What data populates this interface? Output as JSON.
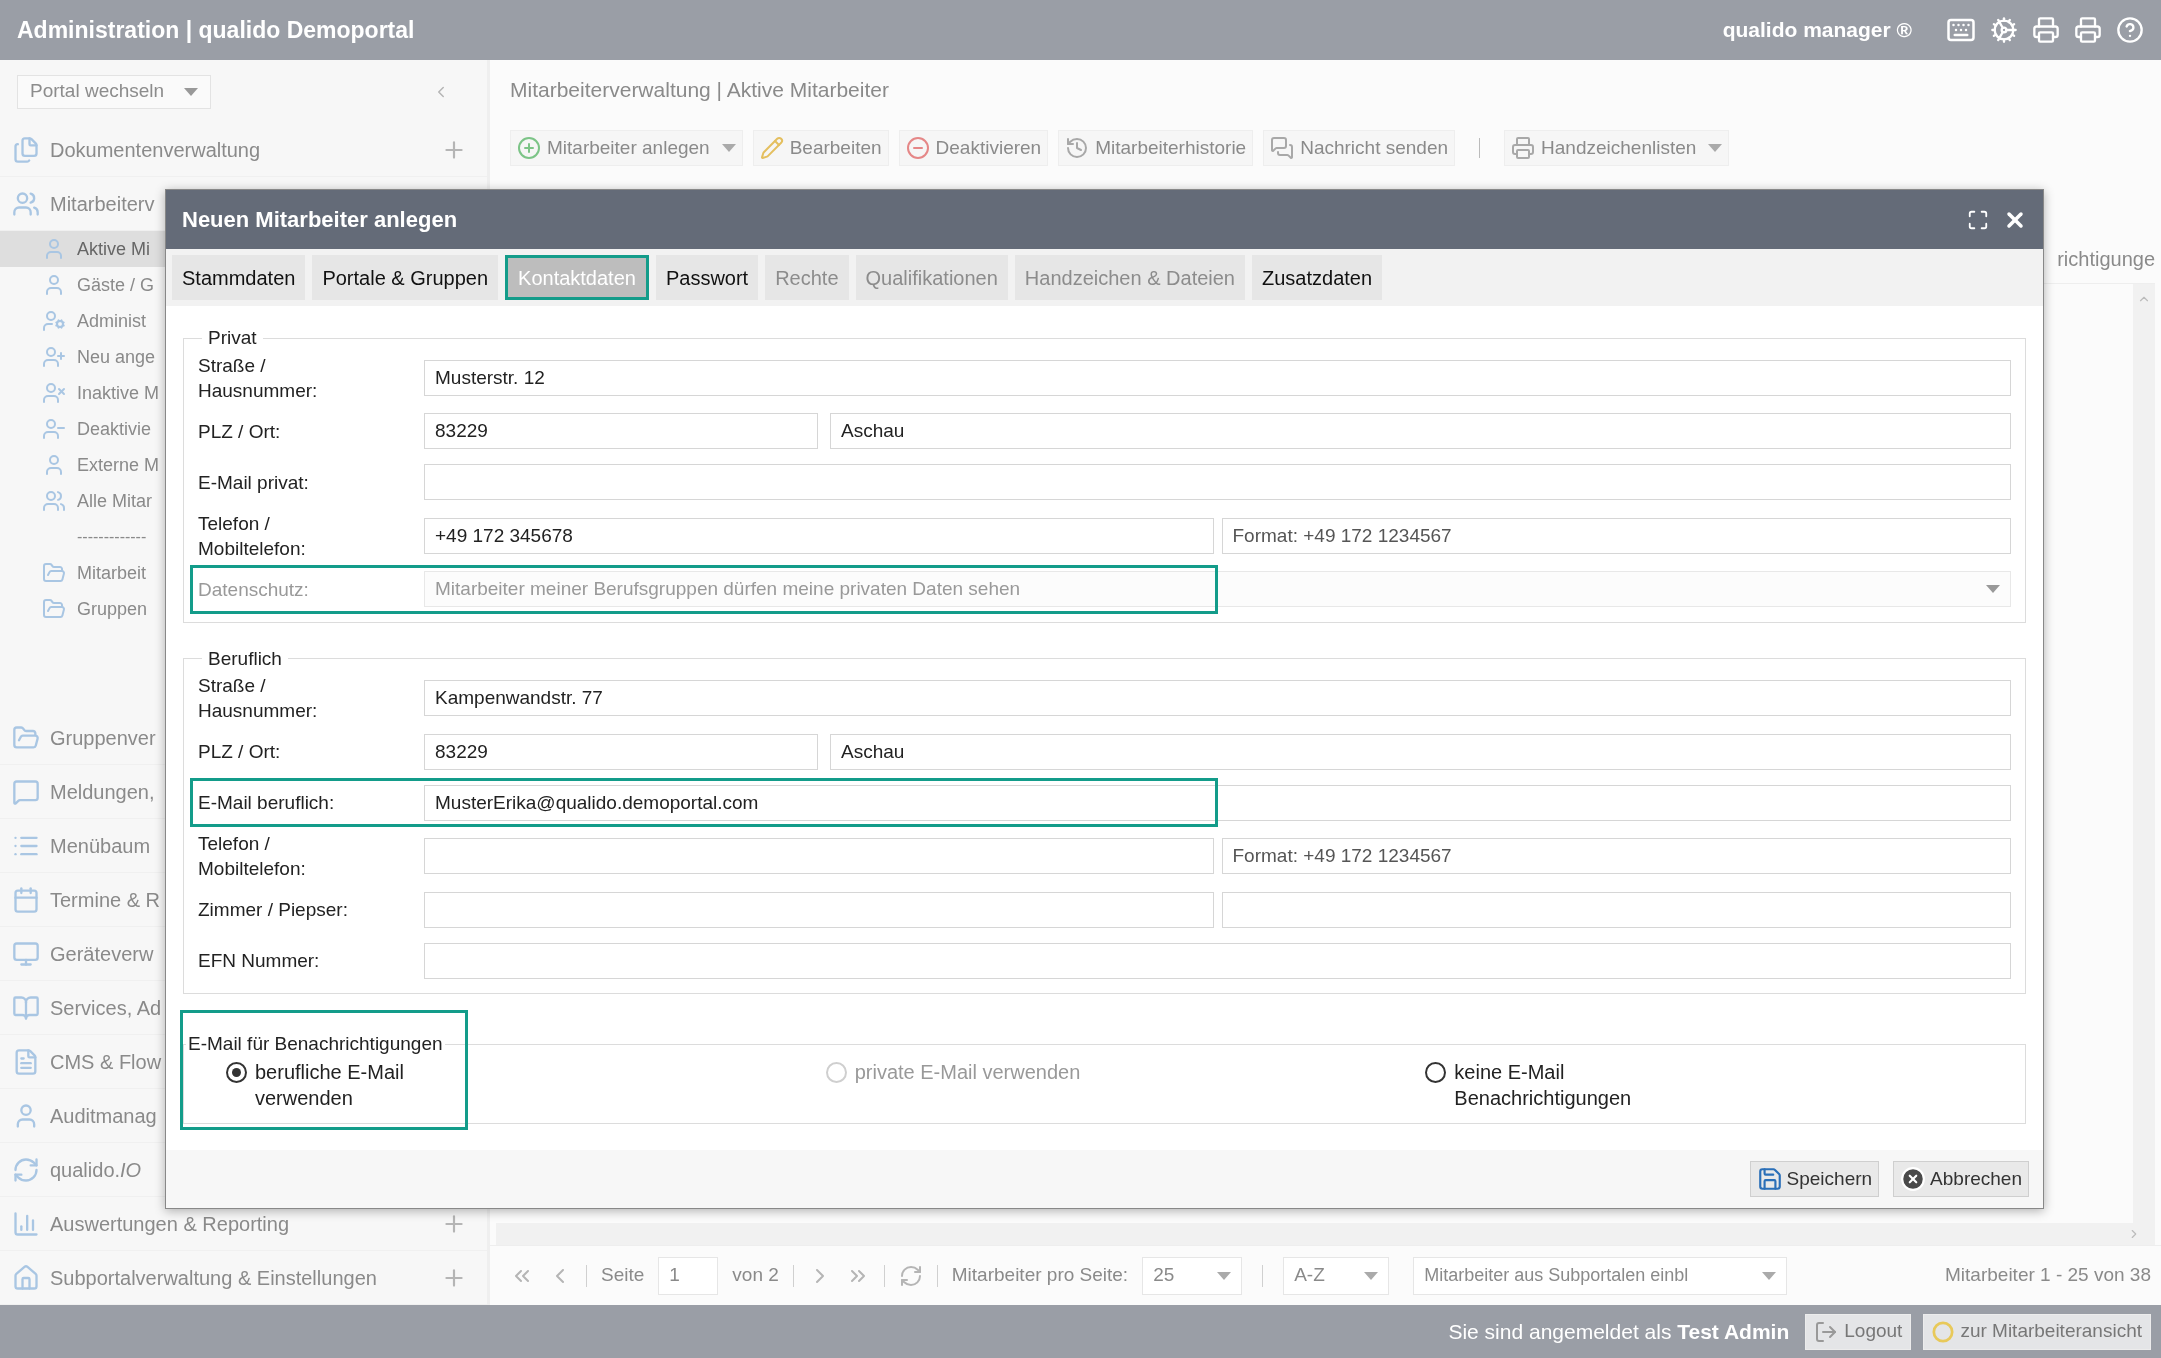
{
  "top_bar": {
    "title": "Administration | qualido Demoportal",
    "product": "qualido manager ®"
  },
  "sidebar": {
    "portal_select": "Portal wechseln",
    "sections": [
      {
        "label": "Dokumentenverwaltung",
        "plus": true
      },
      {
        "label": "Mitarbeiterv",
        "plus": false,
        "children": [
          {
            "kind": "link",
            "label": "Aktive Mi",
            "selected": true
          },
          {
            "kind": "link",
            "label": "Gäste / G",
            "selected": false
          },
          {
            "kind": "link",
            "label": "Administ",
            "selected": false
          },
          {
            "kind": "link",
            "label": "Neu ange",
            "selected": false
          },
          {
            "kind": "link",
            "label": "Inaktive M",
            "selected": false
          },
          {
            "kind": "link",
            "label": "Deaktivie",
            "selected": false
          },
          {
            "kind": "link",
            "label": "Externe M",
            "selected": false
          },
          {
            "kind": "link",
            "label": "Alle Mitar",
            "selected": false
          },
          {
            "kind": "divider",
            "label": "-------------"
          },
          {
            "kind": "link",
            "label": "Mitarbeit",
            "selected": false
          },
          {
            "kind": "link",
            "label": "Gruppen",
            "selected": false
          }
        ]
      },
      {
        "label": "Gruppenver",
        "plus": false
      },
      {
        "label": "Meldungen,",
        "plus": false
      },
      {
        "label": "Menübaum",
        "plus": false
      },
      {
        "label": "Termine & R",
        "plus": false
      },
      {
        "label": "Geräteverw",
        "plus": false
      },
      {
        "label": "Services, Ad",
        "plus": false
      },
      {
        "label": "CMS & Flow",
        "plus": false
      },
      {
        "label": "Auditmanag",
        "plus": false
      },
      {
        "label": "qualido.*IO*",
        "plus": false
      },
      {
        "label": "Auswertungen & Reporting",
        "plus": true
      },
      {
        "label": "Subportalverwaltung & Einstellungen",
        "plus": true
      }
    ]
  },
  "main": {
    "breadcrumb": "Mitarbeiterverwaltung | Aktive Mitarbeiter",
    "toolbar": [
      {
        "label": "Mitarbeiter anlegen",
        "menu": true,
        "separator_before": false
      },
      {
        "label": "Bearbeiten",
        "menu": false,
        "separator_before": false
      },
      {
        "label": "Deaktivieren",
        "menu": false,
        "separator_before": false
      },
      {
        "label": "Mitarbeiterhistorie",
        "menu": false,
        "separator_before": false
      },
      {
        "label": "Nachricht senden",
        "menu": false,
        "separator_before": false
      },
      {
        "label": "Handzeichenlisten",
        "menu": true,
        "separator_before": true
      }
    ],
    "table": {
      "column_header": "richtigunge"
    },
    "pagination": {
      "page_label": "Seite",
      "page": "1",
      "page_count": "von 2",
      "per_page_label": "Mitarbeiter pro Seite:",
      "per_page": "25",
      "sort": "A-Z",
      "subportal_select": "Mitarbeiter aus Subportalen einbl",
      "summary": "Mitarbeiter 1 - 25 von 38"
    }
  },
  "status_bar": {
    "login_text": "Sie sind angemeldet als **Test Admin**",
    "buttons": [
      {
        "label": "Logout"
      },
      {
        "label": "zur Mitarbeiteransicht"
      }
    ]
  },
  "dialog": {
    "title": "Neuen Mitarbeiter anlegen",
    "tabs": [
      {
        "label": "Stammdaten",
        "selected": false,
        "disabled": false
      },
      {
        "label": "Portale & Gruppen",
        "selected": false,
        "disabled": false
      },
      {
        "label": "Kontaktdaten",
        "selected": true,
        "disabled": false
      },
      {
        "label": "Passwort",
        "selected": false,
        "disabled": false
      },
      {
        "label": "Rechte",
        "selected": false,
        "disabled": true
      },
      {
        "label": "Qualifikationen",
        "selected": false,
        "disabled": true
      },
      {
        "label": "Handzeichen & Dateien",
        "selected": false,
        "disabled": true
      },
      {
        "label": "Zusatzdaten",
        "selected": false,
        "disabled": false
      }
    ],
    "sections": [
      {
        "legend": "Privat",
        "rows": [
          {
            "kind": "single",
            "label": "Straße / Hausnummer:",
            "highlighted": false,
            "fields": [
              {
                "kind": "text",
                "value": "Musterstr. 12"
              }
            ]
          },
          {
            "kind": "zip_city",
            "label": "PLZ / Ort:",
            "highlighted": false,
            "fields": [
              {
                "kind": "text",
                "value": "83229"
              },
              {
                "kind": "text",
                "value": "Aschau"
              }
            ]
          },
          {
            "kind": "single",
            "label": "E-Mail privat:",
            "highlighted": false,
            "fields": [
              {
                "kind": "text"
              }
            ]
          },
          {
            "kind": "pair",
            "label": "Telefon / Mobiltelefon:",
            "highlighted": false,
            "fields": [
              {
                "kind": "text",
                "value": "+49 172 345678"
              },
              {
                "kind": "text",
                "placeholder": "Format: +49 172 1234567"
              }
            ]
          },
          {
            "kind": "select",
            "label": "Datenschutz:",
            "highlighted": true,
            "disabled": true,
            "fields": [
              {
                "value": "Mitarbeiter meiner Berufsgruppen dürfen meine privaten Daten sehen"
              }
            ]
          }
        ]
      },
      {
        "legend": "Beruflich",
        "rows": [
          {
            "kind": "single",
            "label": "Straße / Hausnummer:",
            "highlighted": false,
            "fields": [
              {
                "kind": "text",
                "value": "Kampenwandstr. 77"
              }
            ]
          },
          {
            "kind": "zip_city",
            "label": "PLZ / Ort:",
            "highlighted": false,
            "fields": [
              {
                "kind": "text",
                "value": "83229"
              },
              {
                "kind": "text",
                "value": "Aschau"
              }
            ]
          },
          {
            "kind": "single",
            "label": "E-Mail beruflich:",
            "highlighted": true,
            "fields": [
              {
                "kind": "text",
                "value": "MusterErika@qualido.demoportal.com"
              }
            ]
          },
          {
            "kind": "pair",
            "label": "Telefon / Mobiltelefon:",
            "highlighted": false,
            "fields": [
              {
                "kind": "text"
              },
              {
                "kind": "text",
                "placeholder": "Format: +49 172 1234567"
              }
            ]
          },
          {
            "kind": "pair",
            "label": "Zimmer / Piepser:",
            "highlighted": false,
            "fields": [
              {
                "kind": "text"
              },
              {
                "kind": "text"
              }
            ]
          },
          {
            "kind": "single",
            "label": "EFN Nummer:",
            "highlighted": false,
            "fields": [
              {
                "kind": "text"
              }
            ]
          }
        ]
      }
    ],
    "notification": {
      "legend": "E-Mail für Benachrichtigungen",
      "highlighted": true,
      "options": [
        {
          "label": "berufliche E-Mail verwenden",
          "selected": true,
          "disabled": false
        },
        {
          "label": "private E-Mail verwenden",
          "selected": false,
          "disabled": true
        },
        {
          "label": "keine E-Mail Benachrichtigungen",
          "selected": false,
          "disabled": false
        }
      ]
    },
    "buttons": [
      {
        "kind": "save",
        "label": "Speichern"
      },
      {
        "kind": "cancel",
        "label": "Abbrechen"
      }
    ]
  }
}
